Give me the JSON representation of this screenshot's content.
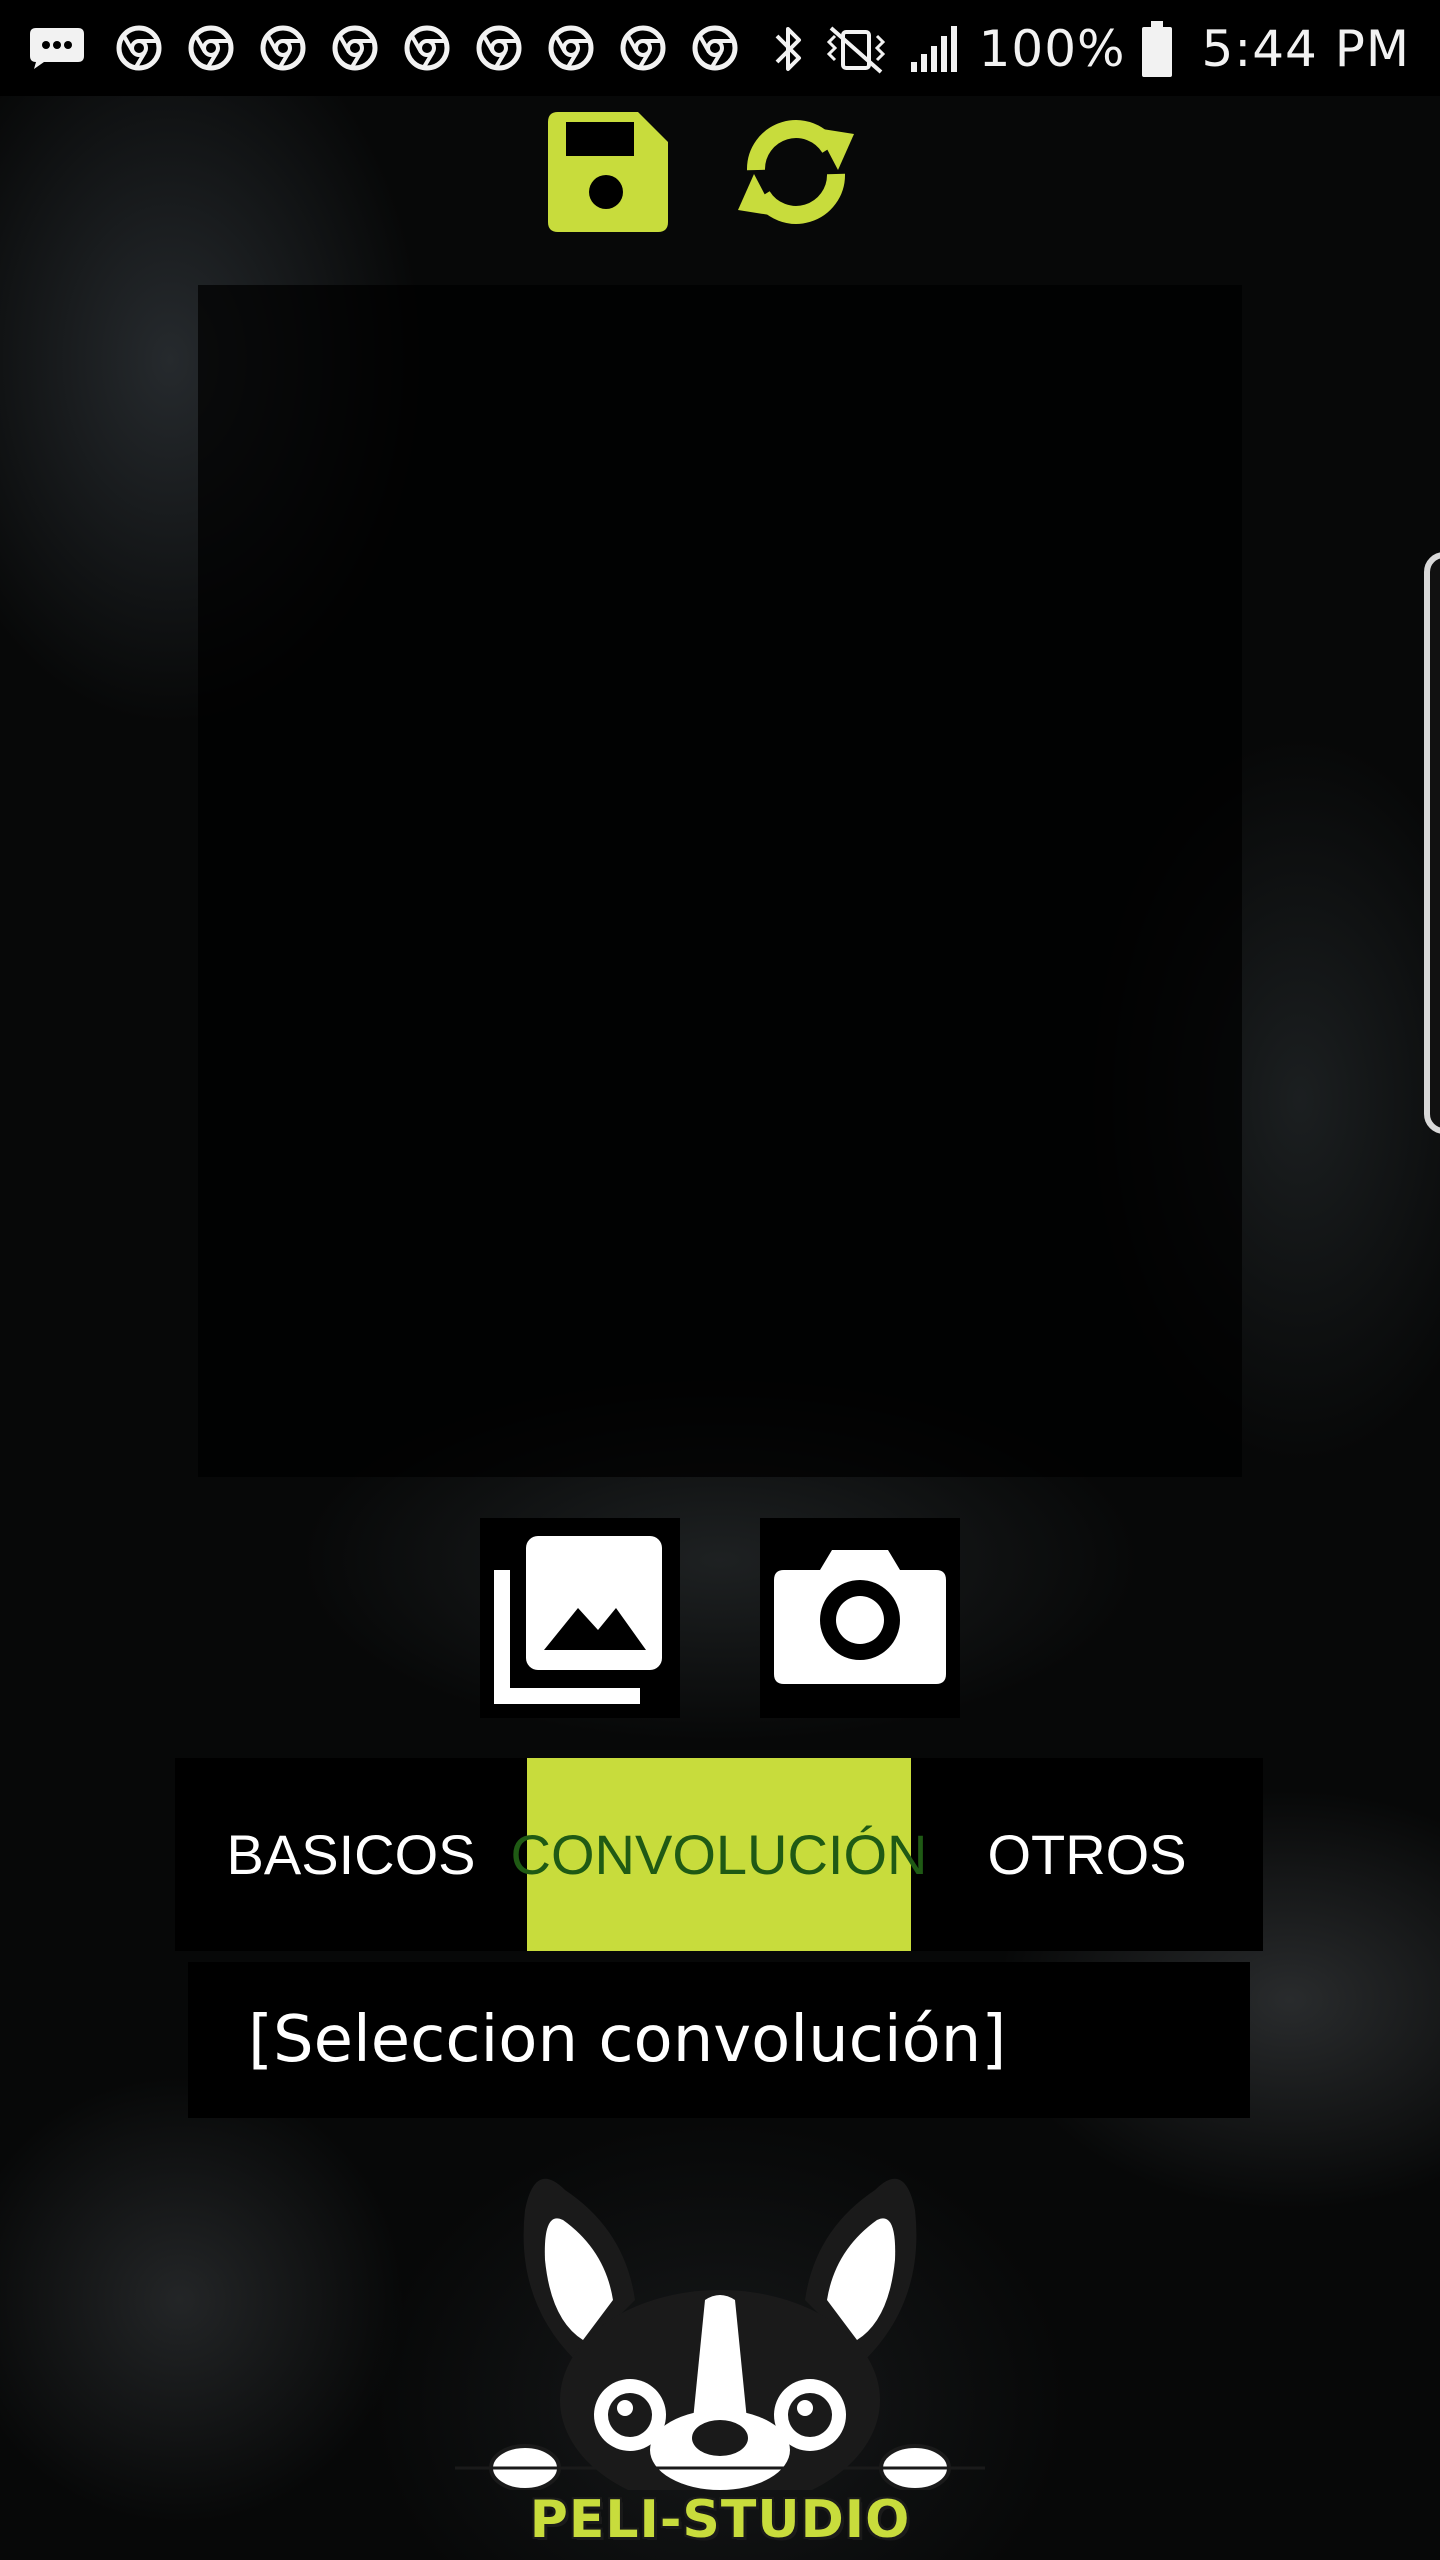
{
  "colors": {
    "accent": "#c8dc3c",
    "active_tab_text": "#1f5a14",
    "background": "#070808",
    "panel": "#000000"
  },
  "status_bar": {
    "icons_left": [
      "message-icon",
      "chrome-icon",
      "chrome-icon",
      "chrome-icon",
      "chrome-icon",
      "chrome-icon",
      "chrome-icon",
      "chrome-icon",
      "chrome-icon",
      "chrome-icon"
    ],
    "icons_right": [
      "bluetooth-icon",
      "vibrate-mute-icon",
      "signal-icon",
      "battery-icon"
    ],
    "battery": "100%",
    "time": "5:44 PM"
  },
  "toolbar": {
    "save_icon": "save-icon",
    "refresh_icon": "refresh-icon"
  },
  "source_buttons": {
    "gallery_icon": "gallery-icon",
    "camera_icon": "camera-icon"
  },
  "tabs": [
    {
      "label": "BASICOS",
      "active": false
    },
    {
      "label": "CONVOLUCIÓN",
      "active": true
    },
    {
      "label": "OTROS",
      "active": false
    }
  ],
  "filter_select": {
    "value": "[Seleccion convolución]"
  },
  "logo": {
    "text": "PELI-STUDIO"
  }
}
